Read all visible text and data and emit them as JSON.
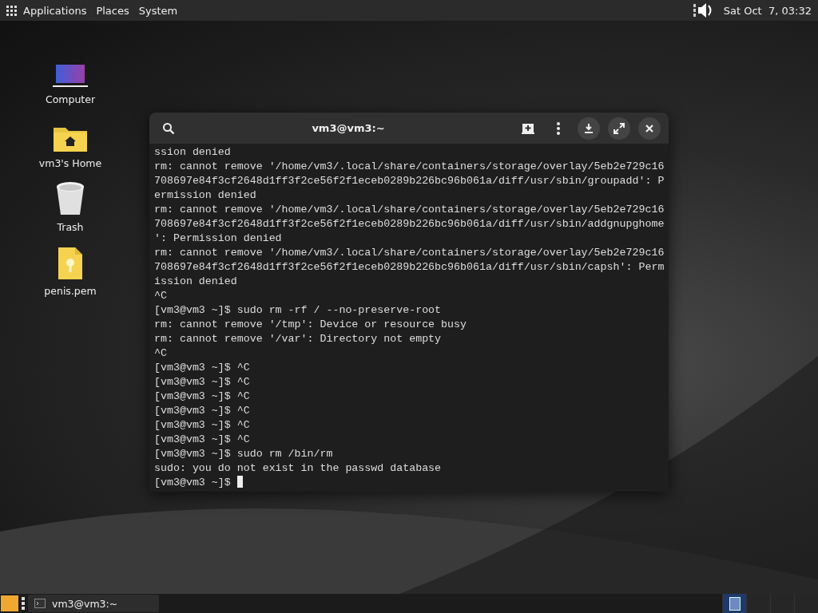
{
  "top_panel": {
    "menus": [
      "Applications",
      "Places",
      "System"
    ],
    "clock": "Sat Oct  7, 03:32"
  },
  "desktop_icons": [
    {
      "kind": "computer",
      "label": "Computer"
    },
    {
      "kind": "home",
      "label": "vm3's Home"
    },
    {
      "kind": "trash",
      "label": "Trash"
    },
    {
      "kind": "file",
      "label": "penis.pem"
    }
  ],
  "terminal": {
    "title": "vm3@vm3:~",
    "lines": [
      "ssion denied",
      "rm: cannot remove '/home/vm3/.local/share/containers/storage/overlay/5eb2e729c16",
      "708697e84f3cf2648d1ff3f2ce56f2f1eceb0289b226bc96b061a/diff/usr/sbin/groupadd': P",
      "ermission denied",
      "rm: cannot remove '/home/vm3/.local/share/containers/storage/overlay/5eb2e729c16",
      "708697e84f3cf2648d1ff3f2ce56f2f1eceb0289b226bc96b061a/diff/usr/sbin/addgnupghome",
      "': Permission denied",
      "rm: cannot remove '/home/vm3/.local/share/containers/storage/overlay/5eb2e729c16",
      "708697e84f3cf2648d1ff3f2ce56f2f1eceb0289b226bc96b061a/diff/usr/sbin/capsh': Perm",
      "ission denied",
      "^C",
      "[vm3@vm3 ~]$ sudo rm -rf / --no-preserve-root",
      "rm: cannot remove '/tmp': Device or resource busy",
      "rm: cannot remove '/var': Directory not empty",
      "^C",
      "[vm3@vm3 ~]$ ^C",
      "[vm3@vm3 ~]$ ^C",
      "[vm3@vm3 ~]$ ^C",
      "[vm3@vm3 ~]$ ^C",
      "[vm3@vm3 ~]$ ^C",
      "[vm3@vm3 ~]$ ^C",
      "[vm3@vm3 ~]$ sudo rm /bin/rm",
      "sudo: you do not exist in the passwd database"
    ],
    "prompt": "[vm3@vm3 ~]$"
  },
  "taskbar": {
    "tasks": [
      {
        "label": "vm3@vm3:~",
        "selected": false
      }
    ],
    "workspaces": [
      {
        "selected": true
      },
      {
        "selected": false
      },
      {
        "selected": false
      },
      {
        "selected": false
      }
    ]
  }
}
